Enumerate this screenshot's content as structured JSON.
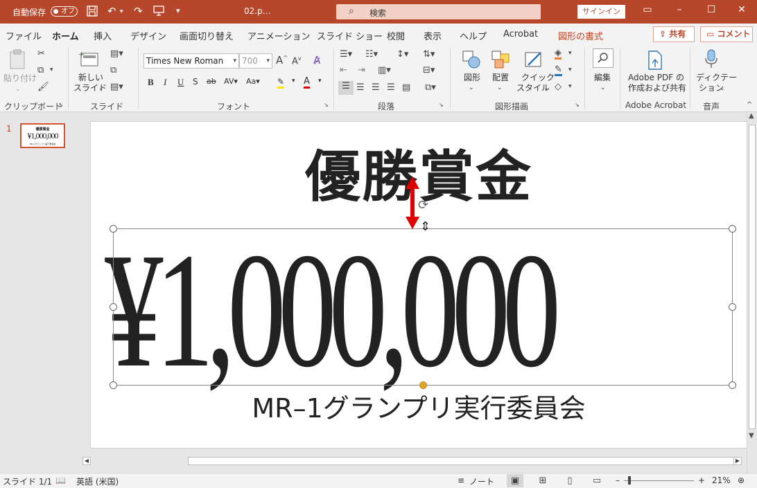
{
  "titlebar": {
    "autosave_label": "自動保存",
    "autosave_state": "オフ",
    "filename": "02.p…",
    "search_placeholder": "検索",
    "signin": "サインイン"
  },
  "tabs": [
    "ファイル",
    "ホーム",
    "挿入",
    "デザイン",
    "画面切り替え",
    "アニメーション",
    "スライド ショー",
    "校閲",
    "表示",
    "ヘルプ",
    "Acrobat",
    "図形の書式"
  ],
  "active_tab": "ホーム",
  "top_buttons": {
    "share": "共有",
    "comment": "コメント"
  },
  "ribbon": {
    "clipboard": {
      "paste": "貼り付け",
      "group": "クリップボード"
    },
    "slides": {
      "new_slide_1": "新しい",
      "new_slide_2": "スライド",
      "group": "スライド"
    },
    "font": {
      "font_name": "Times New Roman",
      "font_size": "700",
      "group": "フォント"
    },
    "paragraph": {
      "group": "段落"
    },
    "drawing": {
      "shape": "図形",
      "arrange": "配置",
      "quick_style_1": "クイック",
      "quick_style_2": "スタイル",
      "group": "図形描画"
    },
    "editing": {
      "edit": "編集"
    },
    "acrobat": {
      "line1": "Adobe PDF の",
      "line2": "作成および共有",
      "group": "Adobe Acrobat"
    },
    "voice": {
      "dictate_1": "ディクテー",
      "dictate_2": "ション",
      "group": "音声"
    }
  },
  "thumbnail": {
    "number": "1",
    "title": "優勝賞金",
    "amount": "¥1,000,000",
    "subtitle": "MR-1グランプリ実行委員会"
  },
  "slide": {
    "title": "優勝賞金",
    "amount": "¥1,000,000",
    "subtitle": "MR–1グランプリ実行委員会"
  },
  "statusbar": {
    "slide_info": "スライド 1/1",
    "language": "英語 (米国)",
    "notes": "ノート",
    "zoom": "21%"
  },
  "colors": {
    "accent": "#b7472a",
    "shape_tab": "#c43e1c",
    "selected_thumb_border": "#d35230"
  }
}
